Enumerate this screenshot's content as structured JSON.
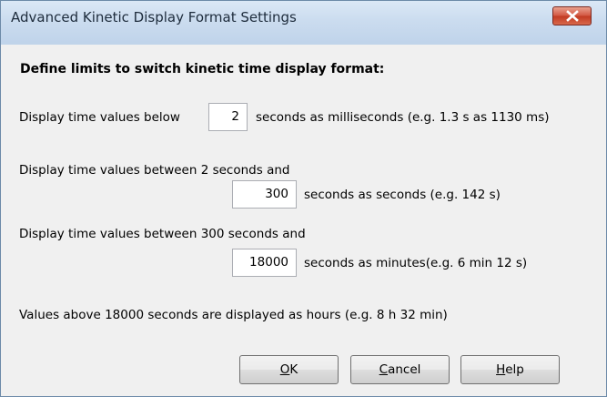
{
  "window": {
    "title": "Advanced Kinetic Display Format Settings",
    "close_icon": "close-icon"
  },
  "heading": "Define limits to switch kinetic time display format:",
  "rows": {
    "ms": {
      "prefix": "Display time values below",
      "value": "2",
      "suffix": "seconds as milliseconds (e.g. 1.3 s as 1130 ms)"
    },
    "sec": {
      "line1": "Display time values between 2 seconds and",
      "value": "300",
      "suffix": "seconds as seconds (e.g. 142 s)"
    },
    "min": {
      "line1": "Display time values between 300 seconds and",
      "value": "18000",
      "suffix": "seconds as minutes(e.g. 6 min 12 s)"
    },
    "hours": {
      "text": "Values above  18000 seconds are displayed as hours (e.g. 8 h 32 min)"
    }
  },
  "buttons": {
    "ok": {
      "mnemonic": "O",
      "rest": "K"
    },
    "cancel": {
      "mnemonic": "C",
      "rest": "ancel"
    },
    "help": {
      "mnemonic": "H",
      "rest": "elp"
    }
  },
  "colors": {
    "titlebar": "#cbdcef",
    "close_button": "#c9452e",
    "dialog_background": "#f0f0f0"
  }
}
